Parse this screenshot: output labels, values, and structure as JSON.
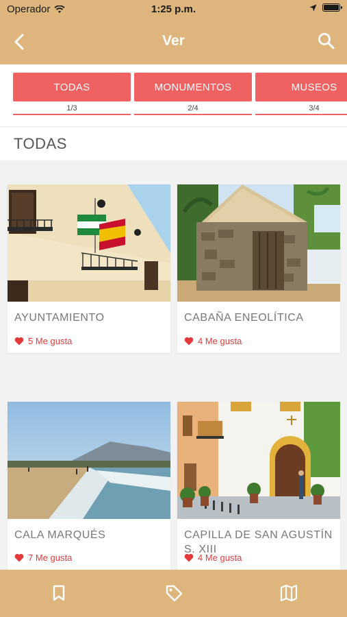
{
  "status_bar": {
    "carrier": "Operador",
    "time": "1:25 p.m."
  },
  "nav": {
    "title": "Ver",
    "back_icon": "chevron-left-icon",
    "search_icon": "search-icon"
  },
  "tabs": [
    {
      "label": "TODAS",
      "count": "1/3"
    },
    {
      "label": "MONUMENTOS",
      "count": "2/4"
    },
    {
      "label": "MUSEOS",
      "count": "3/4"
    }
  ],
  "section": {
    "title": "TODAS"
  },
  "places": [
    {
      "name": "AYUNTAMIENTO",
      "likes": "5 Me gusta"
    },
    {
      "name": "CABAÑA ENEOLÍTICA",
      "likes": "4 Me gusta"
    },
    {
      "name": "CALA MARQUÉS",
      "likes": "7 Me gusta"
    },
    {
      "name": "CAPILLA DE SAN AGUSTÍN S. XIII",
      "likes": "4 Me gusta"
    }
  ],
  "bottom_nav": [
    "bookmark-icon",
    "tag-icon",
    "map-icon"
  ],
  "colors": {
    "header": "#ddb57d",
    "accent": "#f06262",
    "like": "#e23a3a"
  }
}
